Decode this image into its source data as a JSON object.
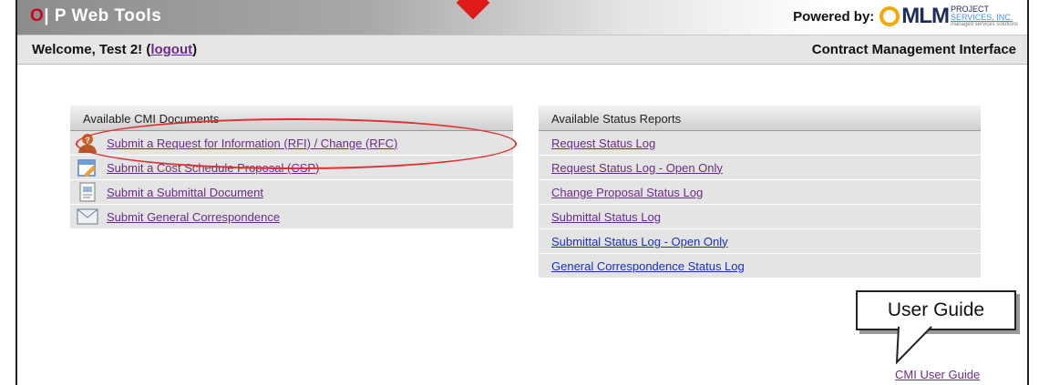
{
  "header": {
    "logo_o": "O",
    "logo_rest": "| P Web Tools",
    "powered_by": "Powered by:",
    "company_logo": {
      "mark": "MLM",
      "line1": "PROJECT",
      "line2": "SERVICES, INC.",
      "line3": "managed services solutions"
    },
    "accent": "#d0021b"
  },
  "subheader": {
    "welcome_prefix": "Welcome, Test 2! (",
    "logout": "logout",
    "welcome_suffix": ")",
    "interface_title": "Contract Management Interface"
  },
  "documents": {
    "title": "Available CMI Documents",
    "items": [
      {
        "label": "Submit a Request for Information (RFI) / Change (RFC)",
        "icon": "person-question-icon"
      },
      {
        "label": "Submit a Cost Schedule Proposal (CSP)",
        "icon": "calendar-edit-icon"
      },
      {
        "label": "Submit a Submittal Document",
        "icon": "document-icon"
      },
      {
        "label": "Submit General Correspondence",
        "icon": "envelope-icon"
      }
    ]
  },
  "reports": {
    "title": "Available Status Reports",
    "items": [
      {
        "label": "Request Status Log"
      },
      {
        "label": "Request Status Log - Open Only"
      },
      {
        "label": "Change Proposal Status Log"
      },
      {
        "label": "Submittal Status Log"
      },
      {
        "label": "Submittal Status Log - Open Only"
      },
      {
        "label": "General Correspondence Status Log"
      }
    ]
  },
  "callout": {
    "text": "User Guide"
  },
  "guide_link": "CMI User Guide"
}
